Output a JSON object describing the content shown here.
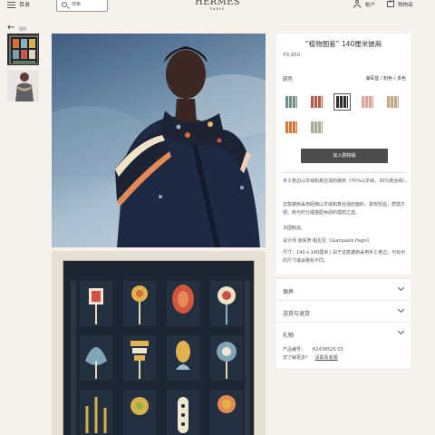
{
  "header": {
    "menu_label": "目录",
    "search_placeholder": "搜索",
    "logo_main": "HERMÈS",
    "logo_sub": "PARIS",
    "account_label": "帐户",
    "bag_label": "购物袋"
  },
  "nav": {
    "back_label": "返回"
  },
  "product": {
    "title": "“植物图鉴” 140厘米披肩",
    "price": "¥9,950",
    "color_label": "颜色",
    "color_value": "海军蓝 / 粉色 / 多色",
    "swatches": [
      {
        "name": "teal-multi",
        "color": "#6c8f92",
        "selected": false
      },
      {
        "name": "red-multi",
        "color": "#b5584a",
        "selected": false
      },
      {
        "name": "navy-multi",
        "color": "#2a2f38",
        "selected": true
      },
      {
        "name": "pink-multi",
        "color": "#d9a3a0",
        "selected": false
      },
      {
        "name": "beige-multi",
        "color": "#bfa98a",
        "selected": false
      },
      {
        "name": "orange-multi",
        "color": "#d7763a",
        "selected": false
      },
      {
        "name": "grey-multi",
        "color": "#a9aa9c",
        "selected": false
      }
    ],
    "add_to_bag": "加入购物袋",
    "material": "手工卷边山羊绒和真丝混纺披肩（70%山羊绒，30%真丝绒）。",
    "description": "这款披肩采用经典山羊绒和真丝混纺面料，柔软轻盈，质感方便。肩与时分或搭配休闲的理想之选。",
    "origin": "法国制造。",
    "designer": "设计师 詹保罗·帕尼尼（Gianpaolo Pagni）",
    "size": "尺寸：140 x 140厘米 | 由于这款披肩采用手工卷边，与标示的尺寸或会略有不同。"
  },
  "accordions": [
    {
      "label": "保养"
    },
    {
      "label": "送货与退货"
    },
    {
      "label": "礼物"
    }
  ],
  "meta": {
    "product_code_label": "产品编号：",
    "product_code": "H243852S 03",
    "help_label": "您了解更多？",
    "contact_label": "请联系客服"
  }
}
